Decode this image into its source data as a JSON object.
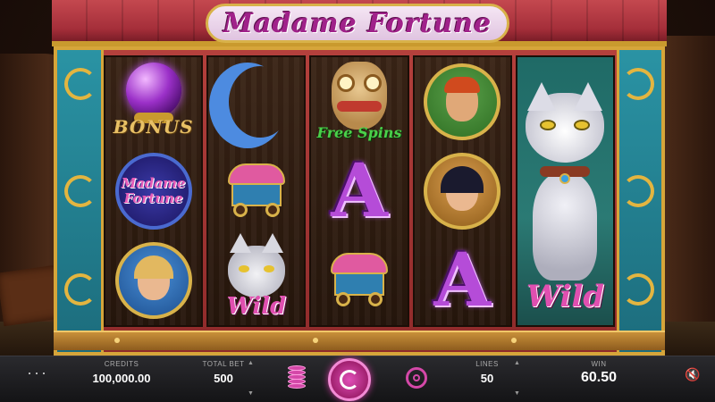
{
  "game": {
    "title": "Madame Fortune"
  },
  "reels": {
    "bonus_label": "BONUS",
    "logo_line1": "Madame",
    "logo_line2": "Fortune",
    "free_spins_label": "Free Spins",
    "letter_a": "A",
    "wild_label": "Wild"
  },
  "controls": {
    "menu_label": "···",
    "credits_label": "CREDITS",
    "credits_value": "100,000.00",
    "total_bet_label": "TOTAL BET",
    "total_bet_value": "500",
    "lines_label": "LINES",
    "lines_value": "50",
    "win_label": "WIN",
    "win_value": "60.50",
    "sound_icon": "speaker-muted-icon"
  },
  "colors": {
    "accent": "#d448a8",
    "title": "#a0228a",
    "frame_gold": "#d6a53a",
    "roof_red": "#b4403c",
    "wild_pink": "#e04fb0"
  }
}
